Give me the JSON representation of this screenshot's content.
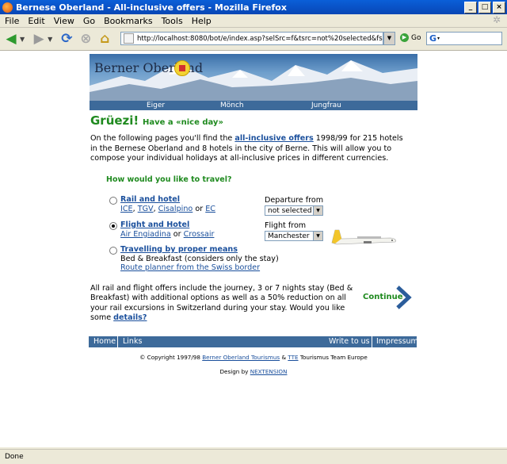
{
  "window": {
    "title": "Bernese Oberland - All-inclusive offers - Mozilla Firefox",
    "controls": [
      "_",
      "□",
      "×"
    ]
  },
  "menu": [
    "File",
    "Edit",
    "View",
    "Go",
    "Bookmarks",
    "Tools",
    "Help"
  ],
  "nav": {
    "url": "http://localhost:8080/bot/e/index.asp?selSrc=f&tsrc=not%20selected&fsrc=Manchester",
    "go_label": "Go",
    "search_value": "G"
  },
  "banner": {
    "logo_text": "Berner Oberland",
    "peaks": [
      "Eiger",
      "Mönch",
      "Jungfrau"
    ]
  },
  "greeting": {
    "title": "Grüezi!",
    "subtitle": "Have a «nice day»"
  },
  "intro": {
    "before": "On the following pages you'll find the ",
    "link": "all-inclusive offers",
    "after": " 1998/99 for 215 hotels in the Bernese Oberland and 8 hotels in the city of Berne. This will allow you to compose your individual holidays at all-inclusive prices in different currencies."
  },
  "question": "How would you like to travel?",
  "options": [
    {
      "title": "Rail and hotel",
      "links": [
        "ICE",
        "TGV",
        "Cisalpino",
        "EC"
      ],
      "sep1": ", ",
      "sep2": ", ",
      "or": " or ",
      "selected": false
    },
    {
      "title": "Flight and Hotel",
      "links": [
        "Air Engiadina",
        "Crossair"
      ],
      "or": " or ",
      "selected": true
    },
    {
      "title": "Travelling by proper means",
      "detail": "Bed & Breakfast (considers only the stay)",
      "link": "Route planner from the Swiss border",
      "selected": false
    }
  ],
  "departure": {
    "label": "Departure from",
    "value": "not selected"
  },
  "flight": {
    "label": "Flight from",
    "value": "Manchester"
  },
  "allrail": {
    "text": "All rail and flight offers include the journey, 3 or 7 nights stay (Bed & Breakfast) with additional options as well as a 50% reduction on all your rail excursions in Switzerland during your stay. Would you like some ",
    "link": "details?"
  },
  "continue_label": "Continue",
  "footer": {
    "left": [
      "Home",
      "Links"
    ],
    "right": [
      "Write to us",
      "Impressum"
    ],
    "copyright_before": "© Copyright 1997/98 ",
    "copyright_link1": "Berner Oberland Tourismus",
    "copyright_mid": " & ",
    "copyright_link2": "TTE",
    "copyright_after": " Tourismus Team Europe",
    "design_before": "Design by ",
    "design_link": "NEXTENSION"
  },
  "status": "Done"
}
